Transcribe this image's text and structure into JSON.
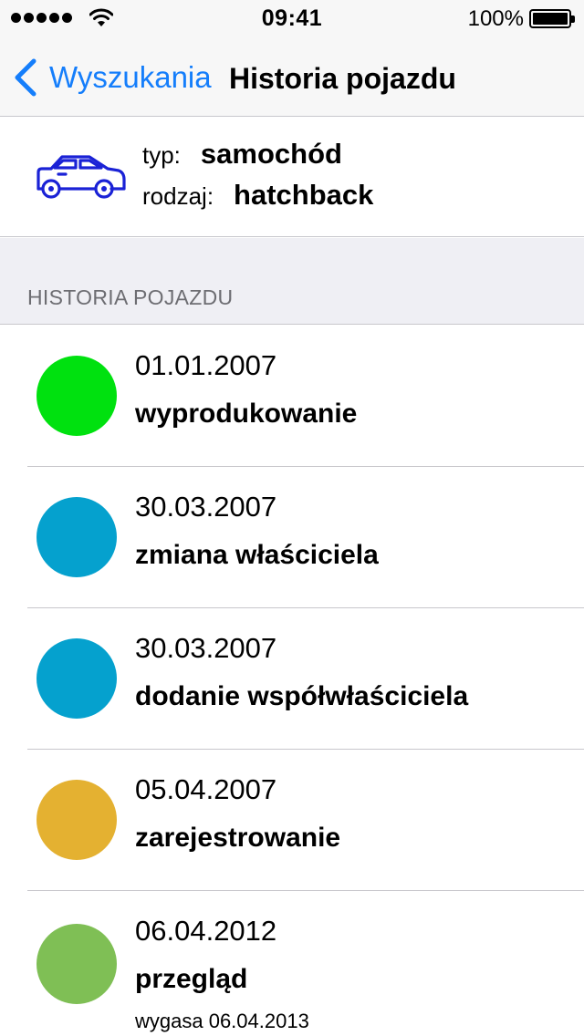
{
  "status_bar": {
    "time": "09:41",
    "battery_percent": "100%",
    "signal_bars": 5,
    "icons": [
      "signal-dots-icon",
      "wifi-icon",
      "battery-icon"
    ]
  },
  "nav": {
    "back_label": "Wyszukania",
    "title": "Historia pojazdu",
    "accent_color": "#157efb"
  },
  "vehicle": {
    "icon": "car-icon",
    "icon_color": "#1a22d6",
    "type_label": "typ:",
    "type_value": "samochód",
    "kind_label": "rodzaj:",
    "kind_value": "hatchback"
  },
  "history": {
    "section_title": "HISTORIA POJAZDU",
    "items": [
      {
        "date": "01.01.2007",
        "event": "wyprodukowanie",
        "color": "#00e10f",
        "note": ""
      },
      {
        "date": "30.03.2007",
        "event": "zmiana właściciela",
        "color": "#05a1ce",
        "note": ""
      },
      {
        "date": "30.03.2007",
        "event": "dodanie współwłaściciela",
        "color": "#05a1ce",
        "note": ""
      },
      {
        "date": "05.04.2007",
        "event": "zarejestrowanie",
        "color": "#e4b131",
        "note": ""
      },
      {
        "date": "06.04.2012",
        "event": "przegląd",
        "color": "#7fbf55",
        "note": "wygasa 06.04.2013"
      }
    ]
  }
}
